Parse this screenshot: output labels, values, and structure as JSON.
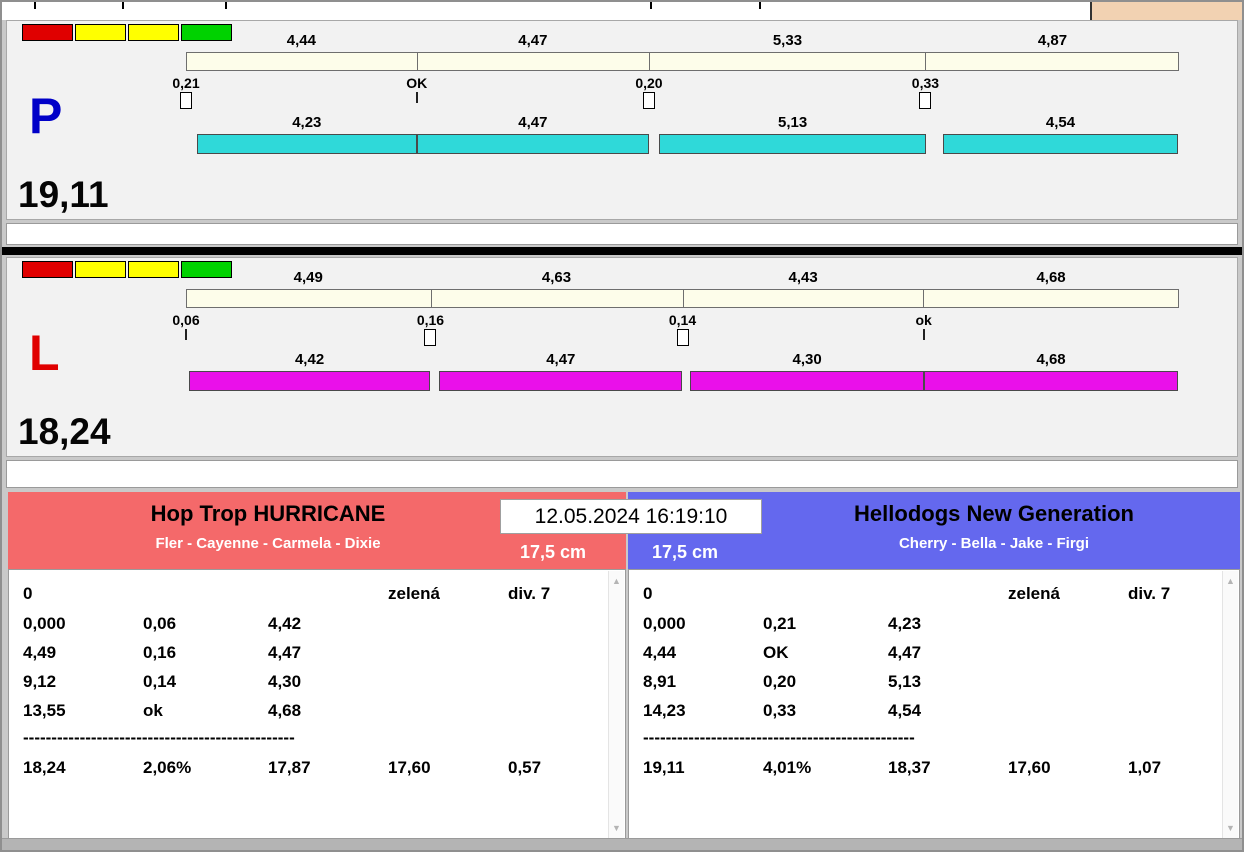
{
  "timestamp": "12.05.2024 16:19:10",
  "traffic_lights": [
    "#e00000",
    "#ffff00",
    "#ffff00",
    "#00d200"
  ],
  "lanes": [
    {
      "letter": "P",
      "letter_color": "#0000c8",
      "total_label": "19,11",
      "total_value": 19.11,
      "run_bar_color": "#2fd9d9",
      "segments": [
        {
          "label": "4,44",
          "value": 4.44
        },
        {
          "label": "4,47",
          "value": 4.47
        },
        {
          "label": "5,33",
          "value": 5.33
        },
        {
          "label": "4,87",
          "value": 4.87
        }
      ],
      "changeovers": [
        {
          "label": "0,21",
          "marker": "box",
          "at": 0
        },
        {
          "label": "OK",
          "marker": "tick",
          "at": 4.44
        },
        {
          "label": "0,20",
          "marker": "box",
          "at": 8.91
        },
        {
          "label": "0,33",
          "marker": "box",
          "at": 14.23
        }
      ],
      "runs": [
        {
          "label": "4,23",
          "value": 4.23,
          "start": 0.21
        },
        {
          "label": "4,47",
          "value": 4.47,
          "start": 4.44
        },
        {
          "label": "5,13",
          "value": 5.13,
          "start": 9.11
        },
        {
          "label": "4,54",
          "value": 4.54,
          "start": 14.56
        }
      ]
    },
    {
      "letter": "L",
      "letter_color": "#e00000",
      "total_label": "18,24",
      "total_value": 18.24,
      "run_bar_color": "#ea10ea",
      "segments": [
        {
          "label": "4,49",
          "value": 4.49
        },
        {
          "label": "4,63",
          "value": 4.63
        },
        {
          "label": "4,43",
          "value": 4.43
        },
        {
          "label": "4,68",
          "value": 4.68
        }
      ],
      "changeovers": [
        {
          "label": "0,06",
          "marker": "tick",
          "at": 0
        },
        {
          "label": "0,16",
          "marker": "box",
          "at": 4.49
        },
        {
          "label": "0,14",
          "marker": "box",
          "at": 9.12
        },
        {
          "label": "ok",
          "marker": "tick",
          "at": 13.55
        }
      ],
      "runs": [
        {
          "label": "4,42",
          "value": 4.42,
          "start": 0.06
        },
        {
          "label": "4,47",
          "value": 4.47,
          "start": 4.65
        },
        {
          "label": "4,30",
          "value": 4.3,
          "start": 9.26
        },
        {
          "label": "4,68",
          "value": 4.68,
          "start": 13.55
        }
      ]
    }
  ],
  "teams": [
    {
      "name": "Hop Trop HURRICANE",
      "dogs": "Fler - Cayenne - Carmela - Dixie",
      "height": "17,5 cm",
      "header_color": "#f4696a",
      "info_row": [
        "0",
        "",
        "",
        "zelená",
        "div. 7"
      ],
      "rows": [
        [
          "0,000",
          "0,06",
          "4,42",
          "",
          ""
        ],
        [
          "4,49",
          "0,16",
          "4,47",
          "",
          ""
        ],
        [
          "9,12",
          "0,14",
          "4,30",
          "",
          ""
        ],
        [
          "13,55",
          "ok",
          "4,68",
          "",
          ""
        ]
      ],
      "separator": "------------------------------------------------",
      "summary": [
        "18,24",
        "2,06%",
        "17,87",
        "17,60",
        "0,57"
      ]
    },
    {
      "name": "Hellodogs New Generation",
      "dogs": "Cherry - Bella - Jake - Firgi",
      "height": "17,5 cm",
      "header_color": "#6468ee",
      "info_row": [
        "0",
        "",
        "",
        "zelená",
        "div. 7"
      ],
      "rows": [
        [
          "0,000",
          "0,21",
          "4,23",
          "",
          ""
        ],
        [
          "4,44",
          "OK",
          "4,47",
          "",
          ""
        ],
        [
          "8,91",
          "0,20",
          "5,13",
          "",
          ""
        ],
        [
          "14,23",
          "0,33",
          "4,54",
          "",
          ""
        ]
      ],
      "separator": "------------------------------------------------",
      "summary": [
        "19,11",
        "4,01%",
        "18,37",
        "17,60",
        "1,07"
      ]
    }
  ]
}
